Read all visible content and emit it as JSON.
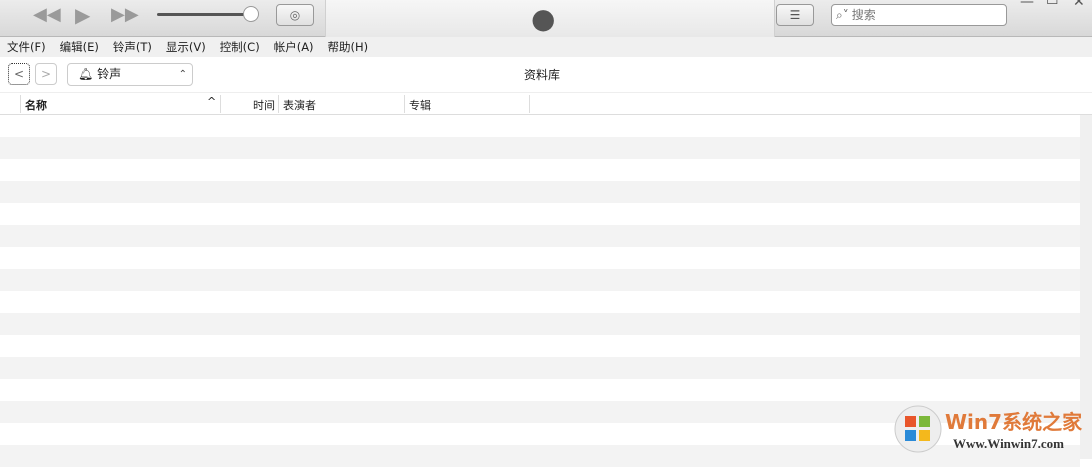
{
  "toolbar": {
    "search_placeholder": "搜索"
  },
  "menu": [
    "文件(F)",
    "编辑(E)",
    "铃声(T)",
    "显示(V)",
    "控制(C)",
    "帐户(A)",
    "帮助(H)"
  ],
  "nav": {
    "source": "铃声",
    "title": "资料库"
  },
  "columns": {
    "name": "名称",
    "time": "时间",
    "artist": "表演者",
    "album": "专辑"
  },
  "watermark": {
    "brand": "Win7系统之家",
    "url": "Www.Winwin7.com"
  }
}
